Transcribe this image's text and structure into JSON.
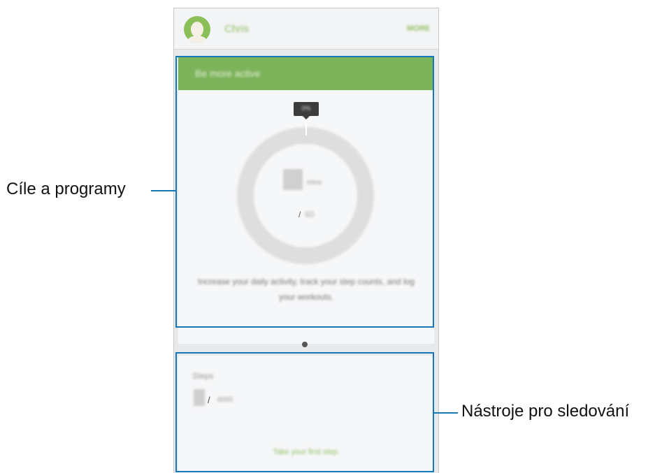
{
  "header": {
    "user_name": "Chris",
    "more_label": "MORE"
  },
  "goal_card": {
    "title": "Be more active",
    "progress_tooltip": "0%",
    "value_unit": "mins",
    "goal_separator": "/",
    "goal_value": "60",
    "description": "Increase your daily activity, track your step counts, and log your workouts."
  },
  "pager": {
    "pages": 1,
    "current": 1
  },
  "tracker_card": {
    "label": "Steps",
    "separator": "/",
    "goal": "6000",
    "hint": "Take your first step."
  },
  "callouts": {
    "goals": "Cíle a programy",
    "trackers": "Nástroje pro sledování"
  },
  "colors": {
    "accent_green": "#7db35a",
    "callout_blue": "#1479b8"
  }
}
